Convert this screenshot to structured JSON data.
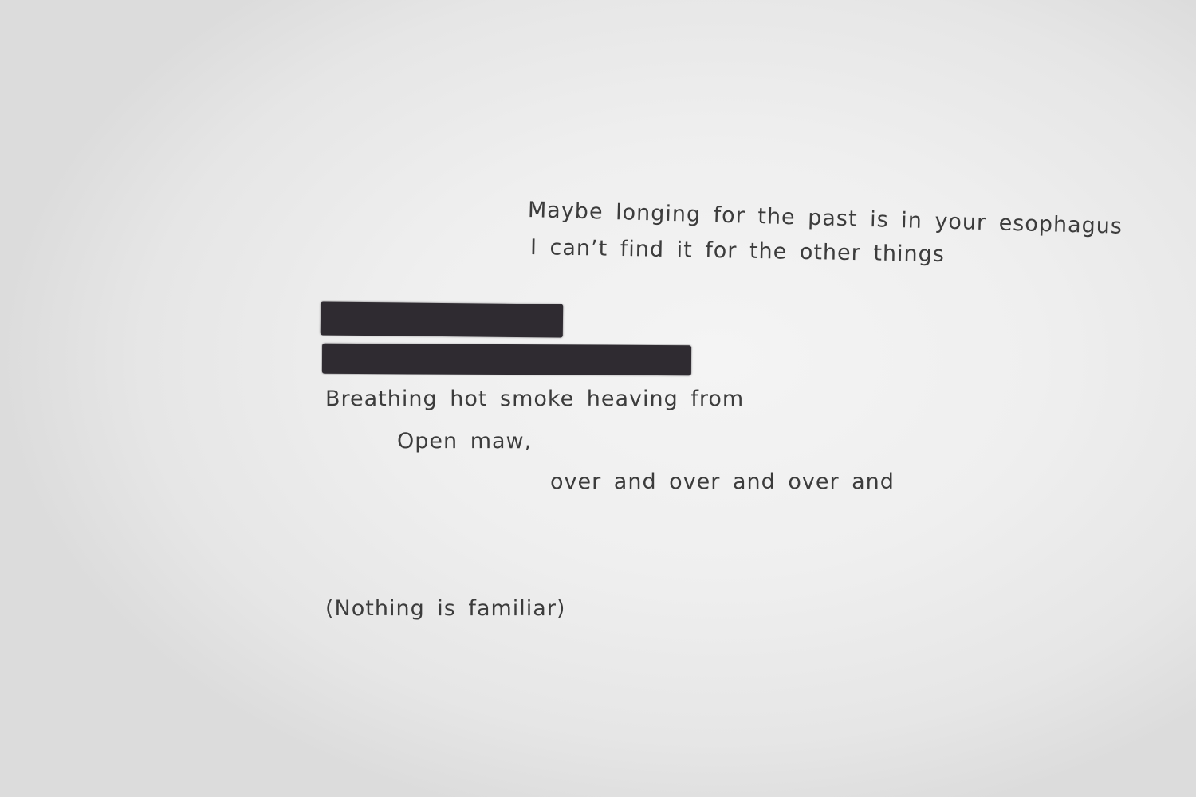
{
  "poem": {
    "line1": "Maybe longing for the past is in your esophagus",
    "line2": "I can’t find it for the other things",
    "line3": "Breathing hot smoke heaving from",
    "line4": "Open maw,",
    "line5": "over and over and over and",
    "line6": "(Nothing is familiar)"
  },
  "colors": {
    "paper": "#efefef",
    "text": "#3c3c3c",
    "redaction_marker": "#2f2b31"
  }
}
